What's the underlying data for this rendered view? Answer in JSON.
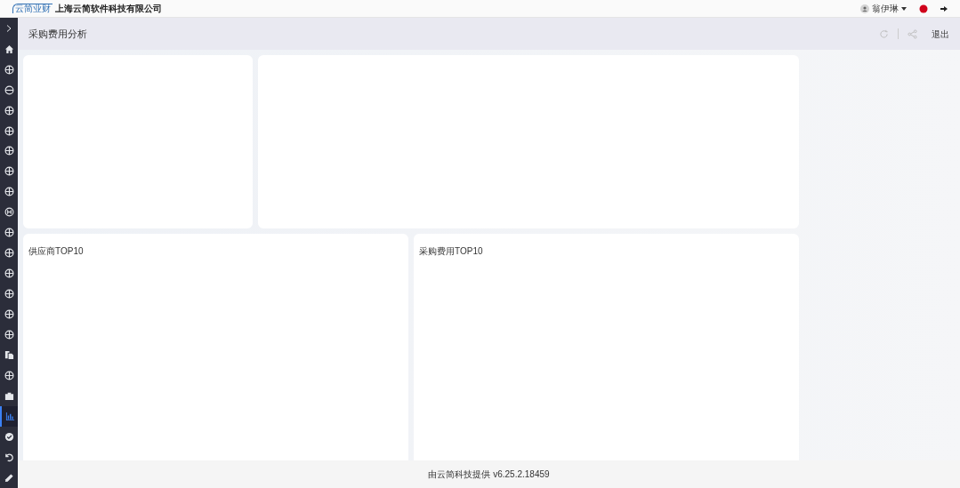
{
  "header": {
    "logo_text": "云简业财",
    "company": "上海云简软件科技有限公司",
    "user": "翁伊琳"
  },
  "sidebar": {
    "items": [
      {
        "kind": "home",
        "selected": false
      },
      {
        "kind": "globe",
        "selected": false
      },
      {
        "kind": "minus",
        "selected": false
      },
      {
        "kind": "globe",
        "selected": false
      },
      {
        "kind": "globe",
        "selected": false
      },
      {
        "kind": "globe",
        "selected": false
      },
      {
        "kind": "globe",
        "selected": false
      },
      {
        "kind": "globe",
        "selected": false
      },
      {
        "kind": "letter",
        "selected": false
      },
      {
        "kind": "globe",
        "selected": false
      },
      {
        "kind": "globe",
        "selected": false
      },
      {
        "kind": "globe",
        "selected": false
      },
      {
        "kind": "globe",
        "selected": false
      },
      {
        "kind": "globe",
        "selected": false
      },
      {
        "kind": "globe",
        "selected": false
      },
      {
        "kind": "copy",
        "selected": false
      },
      {
        "kind": "globe",
        "selected": false
      },
      {
        "kind": "briefcase",
        "selected": false
      },
      {
        "kind": "chart",
        "selected": true
      },
      {
        "kind": "check",
        "selected": false
      },
      {
        "kind": "undo",
        "selected": false
      },
      {
        "kind": "pencil",
        "selected": false
      }
    ]
  },
  "page": {
    "title": "采购费用分析",
    "exit": "退出"
  },
  "cards": [
    {
      "title": "供应商TOP10"
    },
    {
      "title": "采购费用TOP10"
    }
  ],
  "footer": "由云简科技提供 v6.25.2.18459"
}
